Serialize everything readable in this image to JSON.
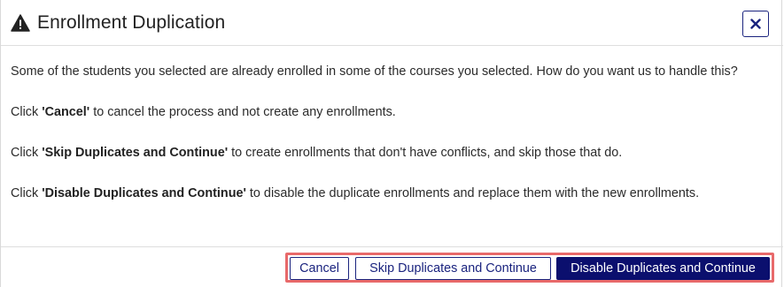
{
  "dialog": {
    "title": "Enrollment Duplication",
    "icons": {
      "title": "warning-triangle-icon",
      "close": "close-x-icon"
    },
    "message": {
      "intro": "Some of the students you selected are already enrolled in some of the courses you selected. How do you want us to handle this?",
      "options": [
        {
          "prefix": "Click ",
          "label": "'Cancel'",
          "text": " to cancel the process and not create any enrollments."
        },
        {
          "prefix": "Click ",
          "label": "'Skip Duplicates and Continue'",
          "text": " to create enrollments that don't have conflicts, and skip those that do."
        },
        {
          "prefix": "Click ",
          "label": "'Disable Duplicates and Continue'",
          "text": " to disable the duplicate enrollments and replace them with the new enrollments."
        }
      ]
    },
    "buttons": {
      "cancel": "Cancel",
      "skip": "Skip Duplicates and Continue",
      "disable": "Disable Duplicates and Continue"
    },
    "colors": {
      "primary": "#0b0f6e",
      "outline": "#1a237e",
      "highlight": "#e8696a"
    }
  }
}
